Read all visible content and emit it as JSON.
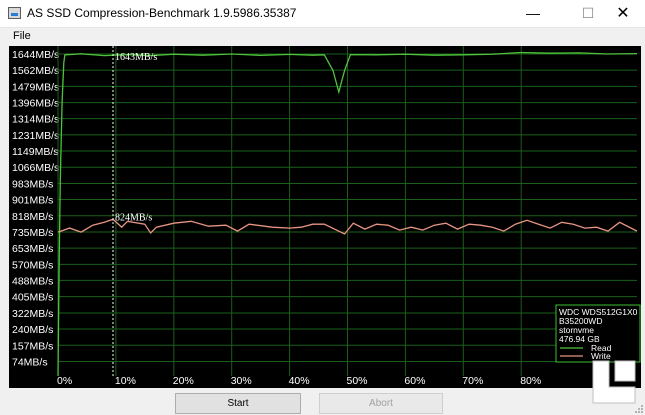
{
  "window": {
    "title": "AS SSD Compression-Benchmark 1.9.5986.35387",
    "minimize_glyph": "—",
    "maximize_glyph": "☐",
    "close_glyph": "✕"
  },
  "menu": {
    "file": "File"
  },
  "chart_data": {
    "type": "line",
    "y_tick_labels": [
      "1644MB/s",
      "1562MB/s",
      "1479MB/s",
      "1396MB/s",
      "1314MB/s",
      "1231MB/s",
      "1149MB/s",
      "1066MB/s",
      "983MB/s",
      "901MB/s",
      "818MB/s",
      "735MB/s",
      "653MB/s",
      "570MB/s",
      "488MB/s",
      "405MB/s",
      "322MB/s",
      "240MB/s",
      "157MB/s",
      "74MB/s"
    ],
    "x_tick_labels": [
      "0%",
      "10%",
      "20%",
      "30%",
      "40%",
      "50%",
      "60%",
      "70%",
      "80%"
    ],
    "ylim": [
      0,
      1685
    ],
    "xlim": [
      0,
      100
    ],
    "grid": true,
    "cursor": {
      "x": 9.5,
      "labels": [
        "1643MB/s",
        "824MB/s"
      ]
    },
    "series": [
      {
        "name": "Read",
        "color": "#4fc33d",
        "points": [
          [
            0,
            0
          ],
          [
            0.2,
            600
          ],
          [
            0.4,
            1000
          ],
          [
            0.7,
            1400
          ],
          [
            1.0,
            1600
          ],
          [
            1.2,
            1640
          ],
          [
            4,
            1645
          ],
          [
            8,
            1636
          ],
          [
            12,
            1641
          ],
          [
            16,
            1636
          ],
          [
            20,
            1643
          ],
          [
            25,
            1638
          ],
          [
            30,
            1644
          ],
          [
            35,
            1637
          ],
          [
            40,
            1642
          ],
          [
            44,
            1638
          ],
          [
            46,
            1640
          ],
          [
            47.5,
            1560
          ],
          [
            48.5,
            1450
          ],
          [
            49.5,
            1560
          ],
          [
            50.5,
            1641
          ],
          [
            55,
            1640
          ],
          [
            60,
            1643
          ],
          [
            65,
            1638
          ],
          [
            70,
            1640
          ],
          [
            75,
            1643
          ],
          [
            80,
            1652
          ],
          [
            85,
            1648
          ],
          [
            90,
            1650
          ],
          [
            95,
            1644
          ],
          [
            100,
            1646
          ]
        ]
      },
      {
        "name": "Write",
        "color": "#e79583",
        "points": [
          [
            0,
            735
          ],
          [
            2,
            755
          ],
          [
            4,
            735
          ],
          [
            6,
            770
          ],
          [
            8,
            785
          ],
          [
            9.5,
            800
          ],
          [
            11,
            760
          ],
          [
            12,
            790
          ],
          [
            15,
            775
          ],
          [
            16,
            730
          ],
          [
            17,
            760
          ],
          [
            20,
            780
          ],
          [
            23,
            790
          ],
          [
            26,
            765
          ],
          [
            29,
            770
          ],
          [
            31,
            740
          ],
          [
            33,
            775
          ],
          [
            37,
            760
          ],
          [
            40,
            755
          ],
          [
            42,
            760
          ],
          [
            44,
            775
          ],
          [
            46,
            775
          ],
          [
            49.5,
            725
          ],
          [
            51,
            780
          ],
          [
            53,
            750
          ],
          [
            55,
            775
          ],
          [
            57,
            770
          ],
          [
            59,
            745
          ],
          [
            61,
            760
          ],
          [
            63,
            745
          ],
          [
            65,
            770
          ],
          [
            67,
            780
          ],
          [
            69,
            750
          ],
          [
            71,
            775
          ],
          [
            73,
            770
          ],
          [
            75,
            760
          ],
          [
            77,
            740
          ],
          [
            79,
            775
          ],
          [
            81,
            795
          ],
          [
            83,
            775
          ],
          [
            85,
            755
          ],
          [
            87,
            785
          ],
          [
            89,
            775
          ],
          [
            91,
            755
          ],
          [
            93,
            760
          ],
          [
            95,
            740
          ],
          [
            97,
            785
          ],
          [
            100,
            740
          ]
        ]
      }
    ],
    "legend": {
      "placement": "bottom-right",
      "lines": [
        "WDC WDS512G1X0",
        "B35200WD",
        "stornvme",
        "476.94 GB"
      ],
      "border_color": "#3bbf2e"
    }
  },
  "buttons": {
    "start": "Start",
    "abort": "Abort"
  }
}
